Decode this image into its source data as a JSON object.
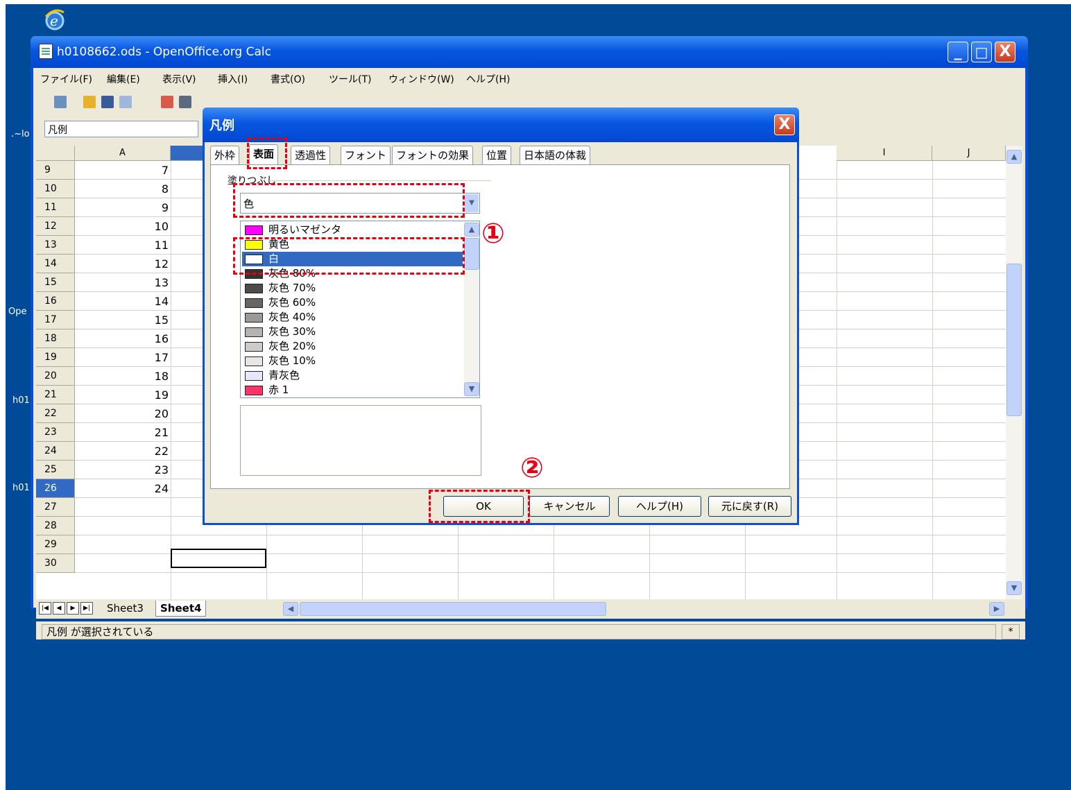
{
  "desktop": {
    "labels": [
      ".~lo",
      "Ope",
      "h01",
      "h01"
    ]
  },
  "window": {
    "title": "h0108662.ods - OpenOffice.org Calc",
    "controls": {
      "minimize": "_",
      "maximize": "□",
      "close": "X"
    }
  },
  "menubar": {
    "items": [
      "ファイル(F)",
      "編集(E)",
      "表示(V)",
      "挿入(I)",
      "書式(O)",
      "ツール(T)",
      "ウィンドウ(W)",
      "ヘルプ(H)"
    ]
  },
  "formulabar": {
    "namebox_value": "凡例"
  },
  "grid": {
    "columns": [
      "A",
      "I",
      "J"
    ],
    "rows": [
      {
        "num": "9",
        "a": "7"
      },
      {
        "num": "10",
        "a": "8"
      },
      {
        "num": "11",
        "a": "9"
      },
      {
        "num": "12",
        "a": "10"
      },
      {
        "num": "13",
        "a": "11"
      },
      {
        "num": "14",
        "a": "12"
      },
      {
        "num": "15",
        "a": "13"
      },
      {
        "num": "16",
        "a": "14"
      },
      {
        "num": "17",
        "a": "15"
      },
      {
        "num": "18",
        "a": "16"
      },
      {
        "num": "19",
        "a": "17"
      },
      {
        "num": "20",
        "a": "18"
      },
      {
        "num": "21",
        "a": "19"
      },
      {
        "num": "22",
        "a": "20"
      },
      {
        "num": "23",
        "a": "21"
      },
      {
        "num": "24",
        "a": "22"
      },
      {
        "num": "25",
        "a": "23"
      },
      {
        "num": "26",
        "a": "24"
      },
      {
        "num": "27",
        "a": ""
      },
      {
        "num": "28",
        "a": ""
      },
      {
        "num": "29",
        "a": ""
      },
      {
        "num": "30",
        "a": ""
      }
    ],
    "selected_row": "26"
  },
  "sheets": {
    "tabs": [
      "Sheet3",
      "Sheet4"
    ],
    "active": "Sheet4"
  },
  "status": {
    "text": "凡例 が選択されている",
    "indicator": "*"
  },
  "dialog": {
    "title": "凡例",
    "tabs": [
      "外枠",
      "表面",
      "透過性",
      "フォント",
      "フォントの効果",
      "位置",
      "日本語の体裁"
    ],
    "active_tab": "表面",
    "fill_label": "塗りつぶし",
    "fill_type": "色",
    "colors": [
      {
        "name": "明るいマゼンタ",
        "hex": "#ff00ff"
      },
      {
        "name": "黄色",
        "hex": "#ffff00"
      },
      {
        "name": "白",
        "hex": "#ffffff"
      },
      {
        "name": "灰色 80%",
        "hex": "#333333"
      },
      {
        "name": "灰色 70%",
        "hex": "#4c4c4c"
      },
      {
        "name": "灰色 60%",
        "hex": "#666666"
      },
      {
        "name": "灰色 40%",
        "hex": "#999999"
      },
      {
        "name": "灰色 30%",
        "hex": "#b3b3b3"
      },
      {
        "name": "灰色 20%",
        "hex": "#cccccc"
      },
      {
        "name": "灰色 10%",
        "hex": "#e6e6e6"
      },
      {
        "name": "青灰色",
        "hex": "#e6e6ff"
      },
      {
        "name": "赤 1",
        "hex": "#ff3366"
      }
    ],
    "selected_color": "白",
    "buttons": {
      "ok": "OK",
      "cancel": "キャンセル",
      "help": "ヘルプ(H)",
      "reset": "元に戻す(R)"
    }
  },
  "annotations": {
    "step1": "①",
    "step2": "②"
  },
  "accent_color": "#e60012"
}
